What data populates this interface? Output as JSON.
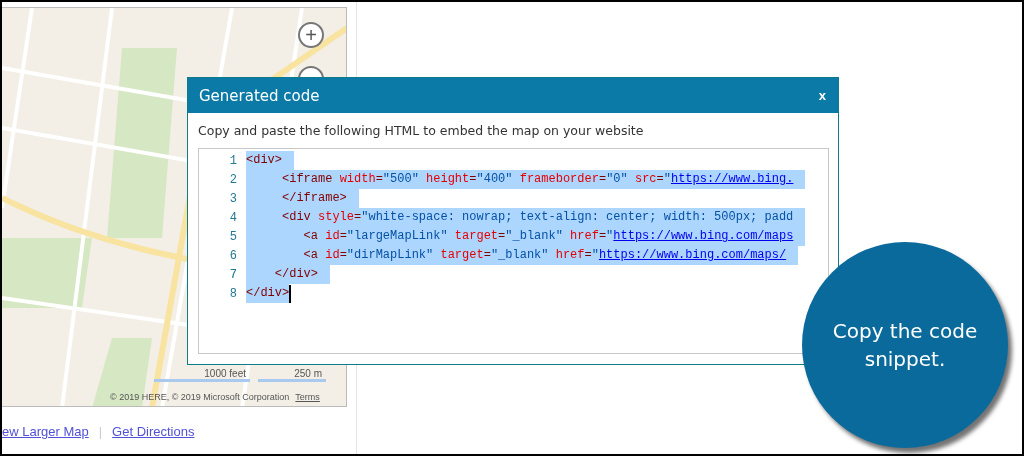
{
  "map": {
    "zoom_in": "+",
    "scale": [
      "1000 feet",
      "250 m"
    ],
    "attribution": "© 2019 HERE, © 2019 Microsoft Corporation",
    "terms": "Terms"
  },
  "links": [
    "ew Larger Map",
    "Get Directions"
  ],
  "separator": "|",
  "dialog": {
    "title": "Generated code",
    "close": "x",
    "instruction": "Copy and paste the following HTML to embed the map on your website",
    "lines": [
      {
        "number": "1",
        "selected": true,
        "caret": false,
        "tokens": [
          {
            "kind": "tag",
            "text": "<div>"
          }
        ]
      },
      {
        "number": "2",
        "selected": true,
        "caret": false,
        "tokens": [
          {
            "kind": "tag",
            "text": "     <iframe "
          },
          {
            "kind": "attr",
            "text": "width"
          },
          {
            "kind": "tag",
            "text": "="
          },
          {
            "kind": "value",
            "text": "\"500\" "
          },
          {
            "kind": "attr",
            "text": "height"
          },
          {
            "kind": "tag",
            "text": "="
          },
          {
            "kind": "value",
            "text": "\"400\" "
          },
          {
            "kind": "attr",
            "text": "frameborder"
          },
          {
            "kind": "tag",
            "text": "="
          },
          {
            "kind": "value",
            "text": "\"0\" "
          },
          {
            "kind": "attr",
            "text": "src"
          },
          {
            "kind": "tag",
            "text": "="
          },
          {
            "kind": "value",
            "text": "\""
          },
          {
            "kind": "link",
            "text": "https://www.bing."
          }
        ]
      },
      {
        "number": "3",
        "selected": true,
        "caret": false,
        "tokens": [
          {
            "kind": "tag",
            "text": "     </iframe>"
          }
        ]
      },
      {
        "number": "4",
        "selected": true,
        "caret": false,
        "tokens": [
          {
            "kind": "tag",
            "text": "     <div "
          },
          {
            "kind": "attr",
            "text": "style"
          },
          {
            "kind": "tag",
            "text": "="
          },
          {
            "kind": "value",
            "text": "\"white-space: nowrap; text-align: center; width: 500px; padd"
          }
        ]
      },
      {
        "number": "5",
        "selected": true,
        "caret": false,
        "tokens": [
          {
            "kind": "tag",
            "text": "        <a "
          },
          {
            "kind": "attr",
            "text": "id"
          },
          {
            "kind": "tag",
            "text": "="
          },
          {
            "kind": "value",
            "text": "\"largeMapLink\" "
          },
          {
            "kind": "attr",
            "text": "target"
          },
          {
            "kind": "tag",
            "text": "="
          },
          {
            "kind": "value",
            "text": "\"_blank\" "
          },
          {
            "kind": "attr",
            "text": "href"
          },
          {
            "kind": "tag",
            "text": "="
          },
          {
            "kind": "value",
            "text": "\""
          },
          {
            "kind": "link",
            "text": "https://www.bing.com/maps"
          }
        ]
      },
      {
        "number": "6",
        "selected": true,
        "caret": false,
        "tokens": [
          {
            "kind": "tag",
            "text": "        <a "
          },
          {
            "kind": "attr",
            "text": "id"
          },
          {
            "kind": "tag",
            "text": "="
          },
          {
            "kind": "value",
            "text": "\"dirMapLink\" "
          },
          {
            "kind": "attr",
            "text": "target"
          },
          {
            "kind": "tag",
            "text": "="
          },
          {
            "kind": "value",
            "text": "\"_blank\" "
          },
          {
            "kind": "attr",
            "text": "href"
          },
          {
            "kind": "tag",
            "text": "="
          },
          {
            "kind": "value",
            "text": "\""
          },
          {
            "kind": "link",
            "text": "https://www.bing.com/maps/"
          }
        ]
      },
      {
        "number": "7",
        "selected": true,
        "caret": false,
        "tokens": [
          {
            "kind": "tag",
            "text": "    </div>"
          }
        ]
      },
      {
        "number": "8",
        "selected": true,
        "caret": true,
        "tokens": [
          {
            "kind": "tag",
            "text": "</div>"
          }
        ]
      }
    ]
  },
  "callout": {
    "text": "Copy the code snippet."
  }
}
